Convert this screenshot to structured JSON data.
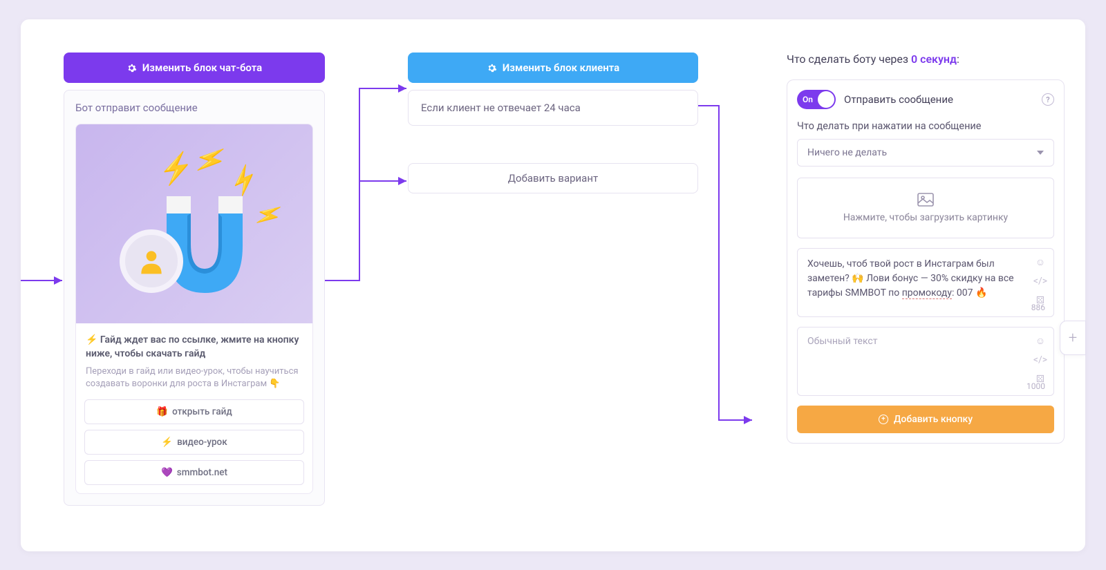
{
  "bot_block": {
    "header_label": "Изменить блок чат-бота",
    "send_label": "Бот отправит сообщение",
    "card": {
      "title_prefix": "⚡",
      "title": "Гайд ждет вас по ссылке, жмите на кнопку ниже, чтобы скачать гайд",
      "desc": "Переходи в гайд или видео-урок, чтобы научиться создавать воронки для роста в Инстаграм 👇"
    },
    "buttons": [
      {
        "icon": "🎁",
        "label": "открыть гайд"
      },
      {
        "icon": "⚡",
        "label": "видео-урок"
      },
      {
        "icon": "💜",
        "label": "smmbot.net"
      }
    ]
  },
  "client_block": {
    "header_label": "Изменить блок клиента",
    "condition_text": "Если клиент не отвечает 24 часа",
    "add_variant": "Добавить вариант"
  },
  "side_panel": {
    "title_prefix": "Что сделать боту через ",
    "seconds": "0 секунд",
    "title_suffix": ":",
    "toggle_state": "On",
    "send_message_label": "Отправить сообщение",
    "click_action_label": "Что делать при нажатии на сообщение",
    "select_value": "Ничего не делать",
    "upload_hint": "Нажмите, чтобы загрузить картинку",
    "text1": "Хочешь, чтоб твой рост в Инстаграм был заметен? 🙌 Лови бонус — 30% скидку на все тарифы SMMBOT по ",
    "text1_underline": "промокоду",
    "text1_tail": ": 007 🔥",
    "text1_count": "886",
    "text2_placeholder": "Обычный текст",
    "text2_count": "1000",
    "add_button_label": "Добавить кнопку"
  }
}
